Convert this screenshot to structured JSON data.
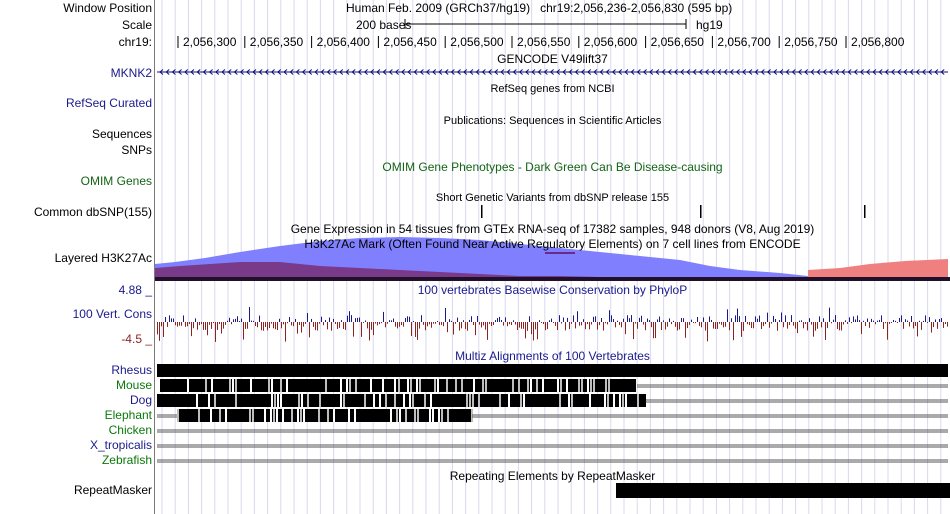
{
  "header": {
    "window_position_label": "Window Position",
    "scale_label": "Scale",
    "chrom_label": "chr19:",
    "assembly_text": "Human Feb. 2009 (GRCh37/hg19)   chr19:2,056,236-2,056,830 (595 bp)",
    "scale_bar_text": "200 bases",
    "scale_db": "hg19",
    "ruler_ticks": [
      "2,056,300",
      "2,056,350",
      "2,056,400",
      "2,056,450",
      "2,056,500",
      "2,056,550",
      "2,056,600",
      "2,056,650",
      "2,056,700",
      "2,056,750",
      "2,056,800"
    ]
  },
  "tracks": {
    "gencode": {
      "title": "GENCODE V49lift37",
      "gene": "MKNK2"
    },
    "refseq": {
      "label": "RefSeq Curated",
      "title": "RefSeq genes from NCBI"
    },
    "publications": {
      "label_sequences": "Sequences",
      "title": "Publications: Sequences in Scientific Articles"
    },
    "omim": {
      "label_snps": "SNPs",
      "label": "OMIM Genes",
      "title": "OMIM Gene Phenotypes - Dark Green Can Be Disease-causing"
    },
    "dbsnp": {
      "label": "Common dbSNP(155)",
      "title": "Short Genetic Variants from dbSNP release 155"
    },
    "gtex": {
      "title": "Gene Expression in 54 tissues from GTEx RNA-seq of 17382 samples, 948 donors (V8, Aug 2019)"
    },
    "h3k27ac": {
      "label": "Layered H3K27Ac",
      "title": "H3K27Ac Mark (Often Found Near Active Regulatory Elements) on 7 cell lines from ENCODE"
    },
    "conservation": {
      "label": "100 Vert. Cons",
      "max_label": "4.88 _",
      "min_label": "-4.5 _",
      "title": "100 vertebrates Basewise Conservation by PhyloP"
    },
    "multiz": {
      "title": "Multiz Alignments of 100 Vertebrates",
      "species": [
        "Rhesus",
        "Mouse",
        "Dog",
        "Elephant",
        "Chicken",
        "X_tropicalis",
        "Zebrafish"
      ]
    },
    "repeatmasker": {
      "label": "RepeatMasker",
      "title": "Repeating Elements by RepeatMasker"
    }
  },
  "colors": {
    "gene_blue": "#0c0c78",
    "label_blue": "#1a1a8c",
    "omim_green": "#146414",
    "multiz_green": "#0a780a",
    "cons_red": "#8b2323",
    "h3k27ac_blue": "#8080ff",
    "h3k27ac_purple": "#7a3a8a",
    "h3k27ac_salmon": "#f08080",
    "grid_line": "#d8d8ee"
  }
}
